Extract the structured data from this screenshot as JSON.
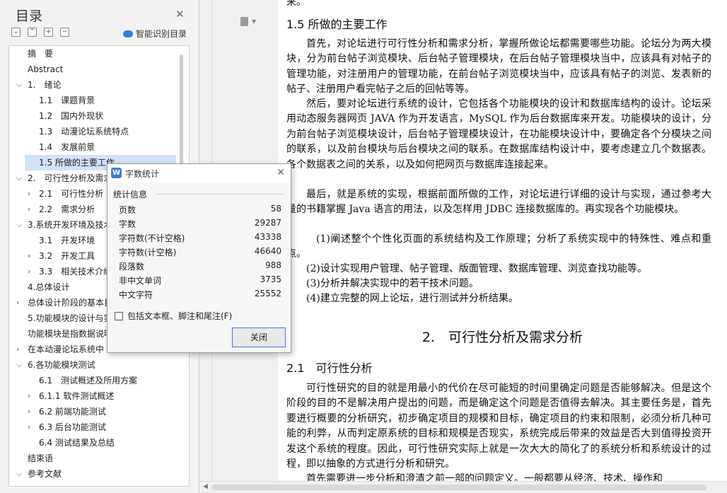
{
  "toc": {
    "title": "目录",
    "smart_label": "智能识别目录",
    "tools": [
      "⌄",
      "⌃",
      "+",
      "−"
    ],
    "items": [
      {
        "label": "摘　要",
        "level": 1,
        "chevron": "",
        "active": false
      },
      {
        "label": "Abstract",
        "level": 1,
        "chevron": "",
        "active": false
      },
      {
        "label": "1.　绪论",
        "level": 1,
        "chevron": "down",
        "active": false
      },
      {
        "label": "1.1　课题背景",
        "level": 2,
        "chevron": "",
        "active": false
      },
      {
        "label": "1.2　国内外现状",
        "level": 2,
        "chevron": "",
        "active": false
      },
      {
        "label": "1.3　动漫论坛系统特点",
        "level": 2,
        "chevron": "",
        "active": false
      },
      {
        "label": "1.4　发展前景",
        "level": 2,
        "chevron": "",
        "active": false
      },
      {
        "label": "1.5 所做的主要工作",
        "level": 2,
        "chevron": "",
        "active": true
      },
      {
        "label": "2.　可行性分析及需求分析",
        "level": 1,
        "chevron": "down",
        "active": false
      },
      {
        "label": "2.1　可行性分析",
        "level": 2,
        "chevron": "right",
        "active": false
      },
      {
        "label": "2.2　需求分析",
        "level": 2,
        "chevron": "right",
        "active": false
      },
      {
        "label": "3.系统开发环境及技术介绍",
        "level": 1,
        "chevron": "down",
        "active": false
      },
      {
        "label": "3.1　开发环境",
        "level": 2,
        "chevron": "",
        "active": false
      },
      {
        "label": "3.2　开发工具",
        "level": 2,
        "chevron": "right",
        "active": false
      },
      {
        "label": "3.3　相关技术介绍",
        "level": 2,
        "chevron": "right",
        "active": false
      },
      {
        "label": "4.总体设计",
        "level": 1,
        "chevron": "",
        "active": false
      },
      {
        "label": "总体设计阶段的基本目的",
        "level": 1,
        "chevron": "right",
        "active": false
      },
      {
        "label": "5.功能模块的设计与实现",
        "level": 1,
        "chevron": "",
        "active": false
      },
      {
        "label": "功能模块是指数据说明",
        "level": 1,
        "chevron": "",
        "active": false
      },
      {
        "label": "在本动漫论坛系统中",
        "level": 1,
        "chevron": "right",
        "active": false
      },
      {
        "label": "6.各功能模块测试",
        "level": 1,
        "chevron": "down",
        "active": false
      },
      {
        "label": "6.1　测试概述及所用方案",
        "level": 2,
        "chevron": "",
        "active": false
      },
      {
        "label": "6.1.1 软件测试概述",
        "level": 2,
        "chevron": "right",
        "active": false
      },
      {
        "label": "6.2 前端功能测试",
        "level": 2,
        "chevron": "right",
        "active": false
      },
      {
        "label": "6.3 后台功能测试",
        "level": 2,
        "chevron": "right",
        "active": false
      },
      {
        "label": "6.4 测试结果及总结",
        "level": 2,
        "chevron": "",
        "active": false
      },
      {
        "label": "结束语",
        "level": 1,
        "chevron": "",
        "active": false
      },
      {
        "label": "参考文献",
        "level": 1,
        "chevron": "down",
        "active": false
      }
    ]
  },
  "dialog": {
    "title": "字数统计",
    "logo": "W",
    "section": "统计信息",
    "stats": [
      {
        "label": "页数",
        "value": "58"
      },
      {
        "label": "字数",
        "value": "29287"
      },
      {
        "label": "字符数(不计空格)",
        "value": "43338"
      },
      {
        "label": "字符数(计空格)",
        "value": "46640"
      },
      {
        "label": "段落数",
        "value": "988"
      },
      {
        "label": "非中文单词",
        "value": "3735"
      },
      {
        "label": "中文字符",
        "value": "25552"
      }
    ],
    "checkbox_label": "包括文本框、脚注和尾注(F)",
    "close_button": "关闭"
  },
  "document": {
    "top_fragment": "来。",
    "heading_15": "1.5 所做的主要工作",
    "para1": "首先，对论坛进行可行性分析和需求分析，掌握所做论坛都需要哪些功能。论坛分为两大模块，分为前台帖子浏览模块、后台帖子管理模块，在后台帖子管理模块当中，应该具有对帖子的管理功能，对注册用户的管理功能，在前台帖子浏览模块当中，应该具有帖子的浏览、发表新的帖子、注册用户看完帖子之后的回帖等等。",
    "para2": "然后，要对论坛进行系统的设计，它包括各个功能模块的设计和数据库结构的设计。论坛采用动态服务器网页 JAVA 作为开发语言，MySQL 作为后台数据库来开发。功能模块的设计，分为前台帖子浏览模块设计，后台帖子管理模块设计，在功能模块设计中，要确定各个分模块之间的联系，以及前台模块与后台模块之间的联系。在数据库结构设计中，要考虑建立几个数据表。各个数据表之间的关系，以及如何把网页与数据库连接起来。",
    "para3": "最后，就是系统的实现，根据前面所做的工作，对论坛进行详细的设计与实现，通过参考大量的书籍掌握 Java 语言的用法，以及怎样用 JDBC 连接数据库的。再实现各个功能模块。",
    "para4": "(1)阐述整个个性化页面的系统结构及工作原理；分析了系统实现中的特殊性、难点和重点。",
    "list": [
      "(2)设计实现用户管理、帖子管理、版面管理、数据库管理、浏览查找功能等。",
      "(3)分析并解决实现中的若干技术问题。",
      "(4)建立完整的网上论坛，进行测试并分析结果。"
    ],
    "chapter2": "2.　可行性分析及需求分析",
    "heading_21": "2.1　可行性分析",
    "para5": "可行性研究的目的就是用最小的代价在尽可能短的时间里确定问题是否能够解决。但是这个阶段的目的不是解决用户提出的问题，而是确定这个问题是否值得去解决。其主要任务是，首先要进行概要的分析研究，初步确定项目的规模和目标，确定项目的约束和限制，必须分析几种可能的利弊，从而判定原系统的目标和规模是否现实，系统完成后带来的效益是否大到值得投资开发这个系统的程度。因此，可行性研究实际上就是一次大大的简化了的系统分析和系统设计的过程，即以抽象的方式进行分析和研究。",
    "para6": "首先需要进一步分析和澄清之前一部的问题定义。一般都要从经济、技术、操作和"
  }
}
